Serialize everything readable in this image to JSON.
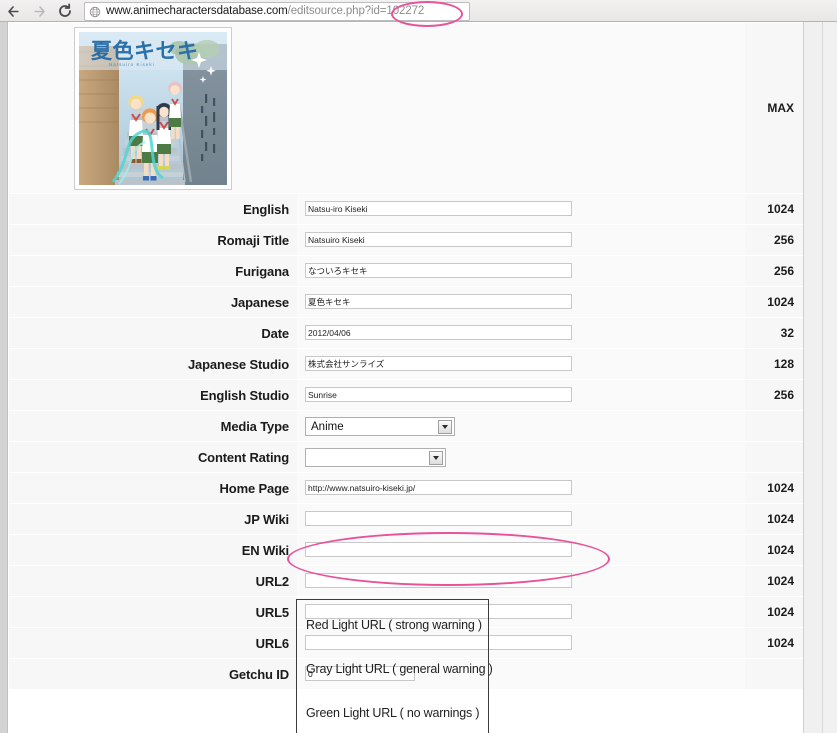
{
  "browser": {
    "back_icon": "arrow-left-icon",
    "forward_icon": "arrow-right-icon",
    "reload_icon": "reload-icon",
    "home_icon": "home-icon",
    "page_icon": "globe-icon",
    "url_host": "www.animecharactersdatabase.com",
    "url_path": "/editsource.php?id=102272",
    "url_full": "www.animecharactersdatabase.com/editsource.php?id=102272"
  },
  "cover": {
    "alt": "Natsu-iro Kiseki anime key visual - four schoolgirls on stairs",
    "logo_text": "夏色キセキ",
    "logo_sub": "Natsuiro Kiseki"
  },
  "table": {
    "max_header": "MAX",
    "rows": [
      {
        "label": "English",
        "value": "Natsu-iro Kiseki",
        "max": "1024",
        "type": "text"
      },
      {
        "label": "Romaji Title",
        "value": "Natsuiro Kiseki",
        "max": "256",
        "type": "text"
      },
      {
        "label": "Furigana",
        "value": "なついろキセキ",
        "max": "256",
        "type": "text"
      },
      {
        "label": "Japanese",
        "value": "夏色キセキ",
        "max": "1024",
        "type": "text"
      },
      {
        "label": "Date",
        "value": "2012/04/06",
        "max": "32",
        "type": "text"
      },
      {
        "label": "Japanese Studio",
        "value": "株式会社サンライズ",
        "max": "128",
        "type": "text"
      },
      {
        "label": "English Studio",
        "value": "Sunrise",
        "max": "256",
        "type": "text"
      },
      {
        "label": "Media Type",
        "value": "Anime",
        "max": "",
        "type": "select"
      },
      {
        "label": "Content Rating",
        "value": "",
        "max": "",
        "type": "select"
      },
      {
        "label": "Home Page",
        "value": "http://www.natsuiro-kiseki.jp/",
        "max": "1024",
        "type": "text"
      },
      {
        "label": "JP Wiki",
        "value": "",
        "max": "1024",
        "type": "text"
      },
      {
        "label": "EN Wiki",
        "value": "",
        "max": "1024",
        "type": "text"
      },
      {
        "label": "URL2",
        "value": "",
        "max": "1024",
        "type": "text"
      },
      {
        "label": "URL5",
        "value": "",
        "max": "1024",
        "type": "text"
      },
      {
        "label": "URL6",
        "value": "",
        "max": "1024",
        "type": "text"
      },
      {
        "label": "Getchu ID",
        "value": "0",
        "max": "",
        "type": "text-short"
      }
    ]
  },
  "tooltip": {
    "red_line": "Red Light URL ( strong warning )",
    "gray_line": "Gray Light URL ( general warning )",
    "green_line": "Green Light URL ( no warnings )"
  },
  "annotations": {
    "accent_color": "#e8529b",
    "url_ellipse_label": "highlight-source-id",
    "wiki_ellipse_label": "highlight-wiki-fields"
  }
}
